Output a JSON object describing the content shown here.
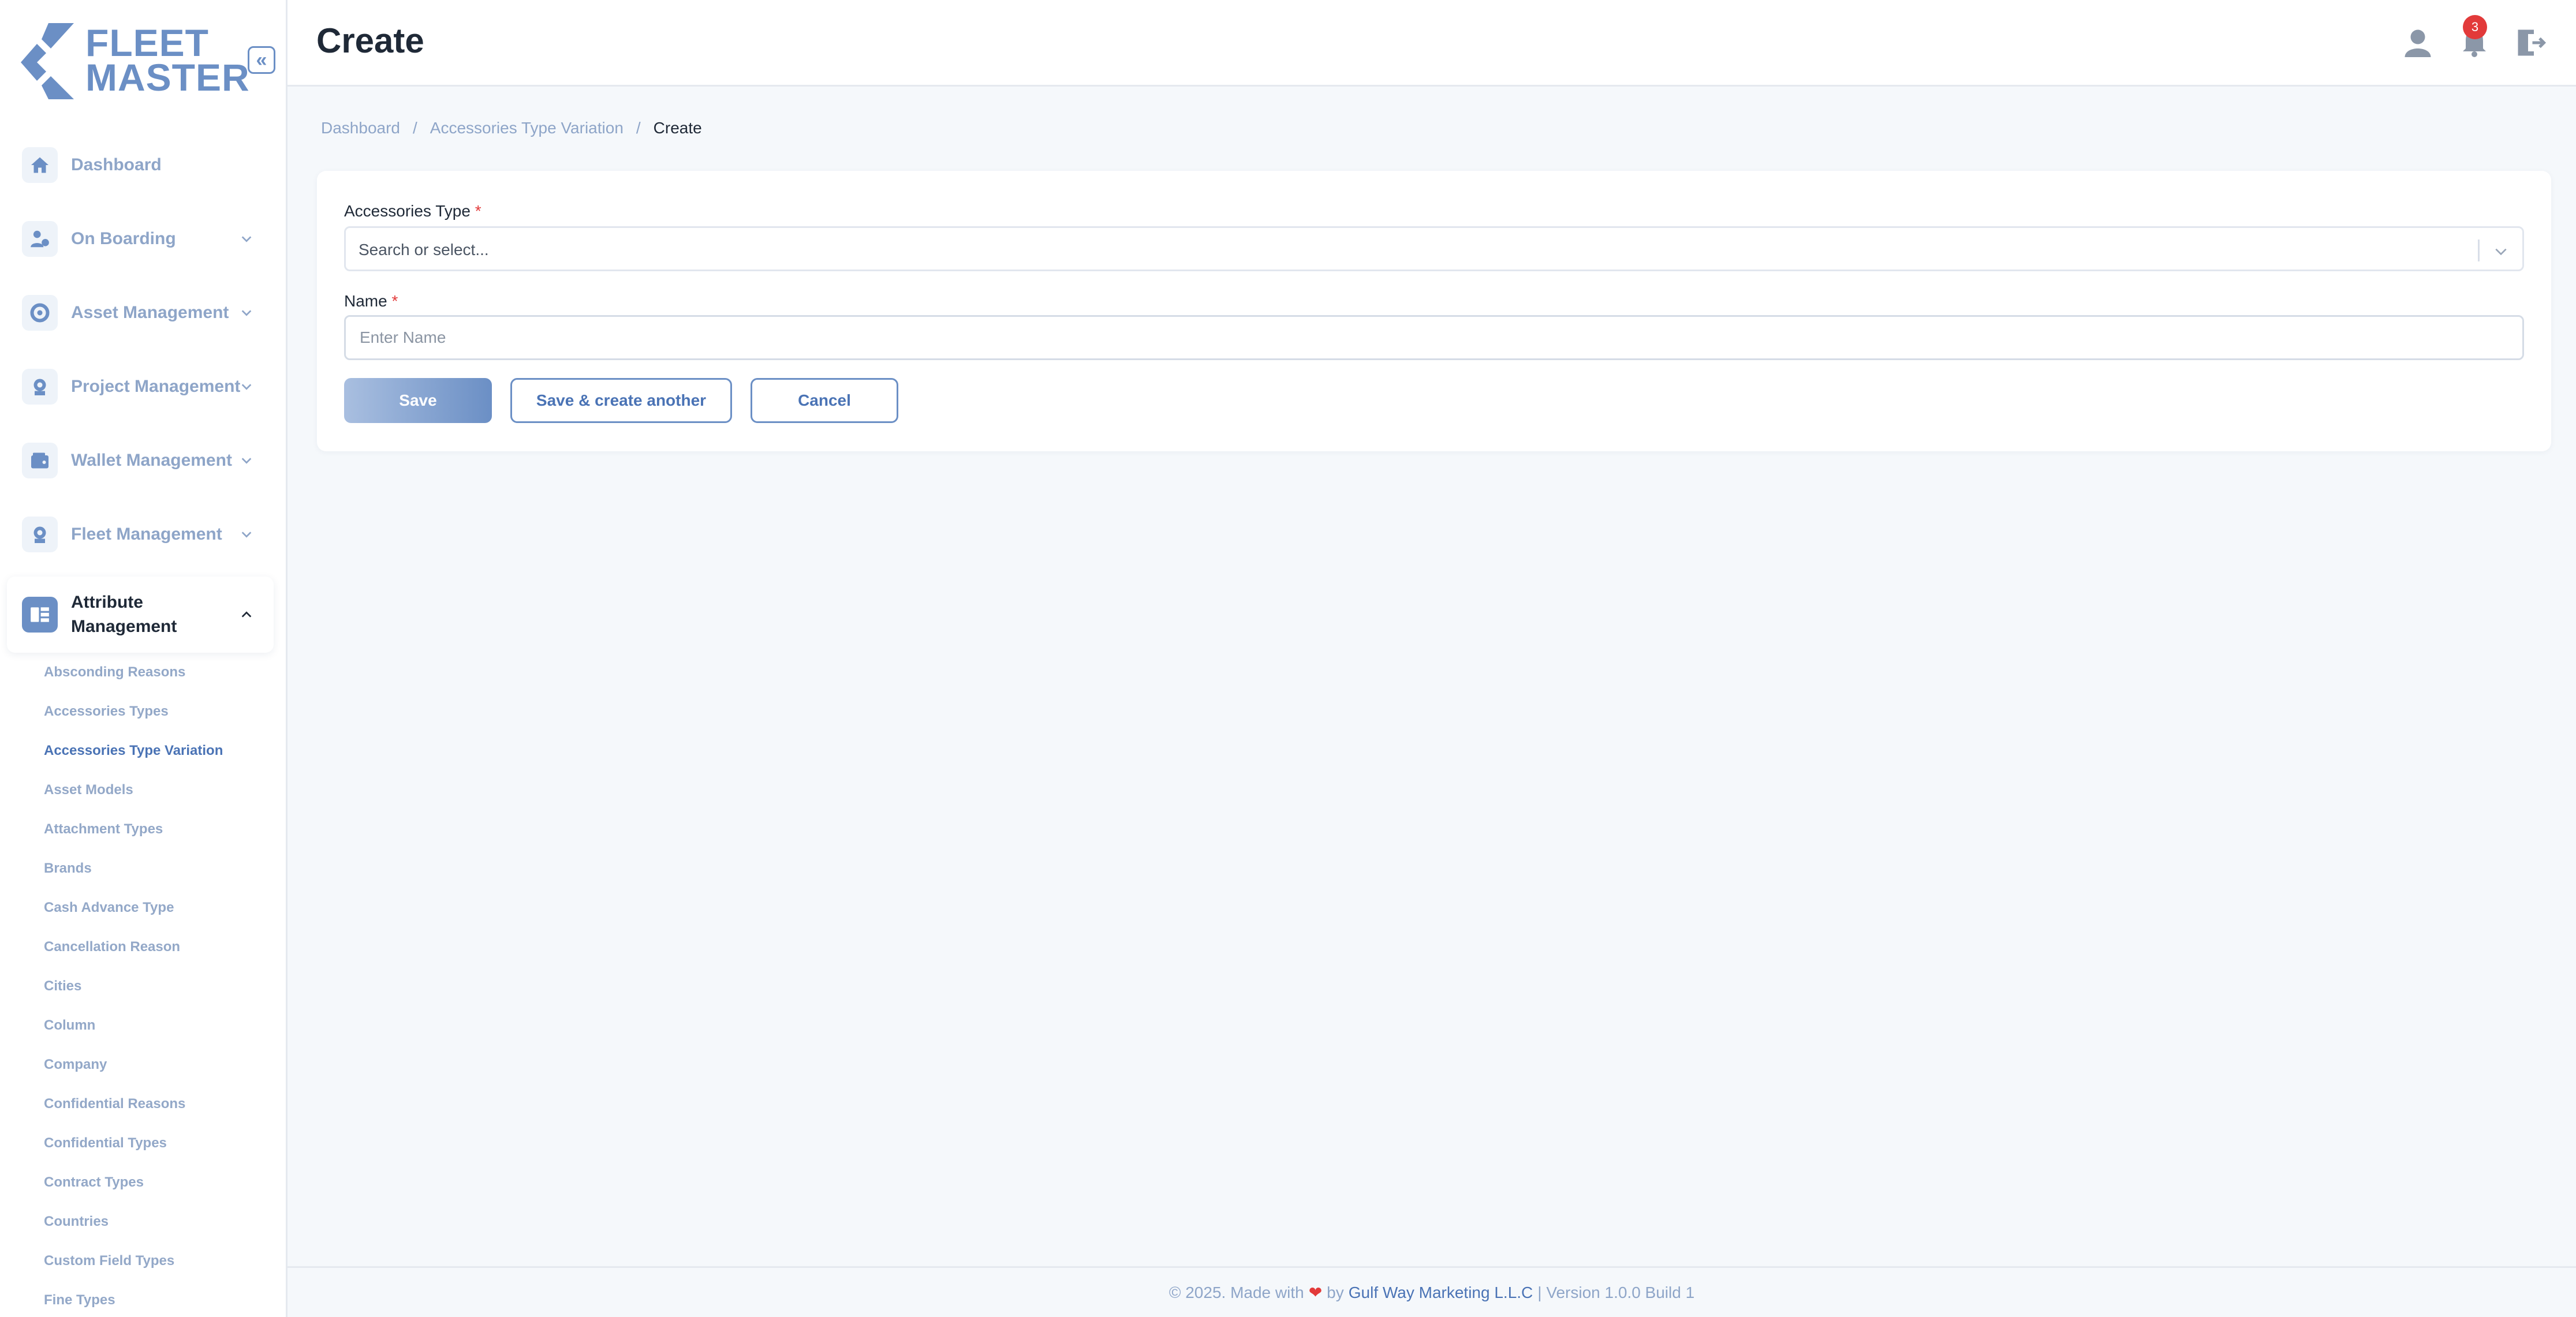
{
  "app": {
    "logo_line1": "FLEET",
    "logo_line2": "MASTER"
  },
  "header": {
    "title": "Create",
    "notification_count": "3"
  },
  "sidebar": {
    "collapse_glyph": "«",
    "items": [
      {
        "label": "Dashboard",
        "icon": "home-icon"
      },
      {
        "label": "On Boarding",
        "icon": "user-onboarding-icon"
      },
      {
        "label": "Asset Management",
        "icon": "asset-icon"
      },
      {
        "label": "Project Management",
        "icon": "project-icon"
      },
      {
        "label": "Wallet Management",
        "icon": "wallet-icon"
      },
      {
        "label": "Fleet Management",
        "icon": "fleet-icon"
      },
      {
        "label_line1": "Attribute",
        "label_line2": "Management",
        "icon": "attribute-icon"
      }
    ],
    "sub_items": [
      "Absconding Reasons",
      "Accessories Types",
      "Accessories Type Variation",
      "Asset Models",
      "Attachment Types",
      "Brands",
      "Cash Advance Type",
      "Cancellation Reason",
      "Cities",
      "Column",
      "Company",
      "Confidential Reasons",
      "Confidential Types",
      "Contract Types",
      "Countries",
      "Custom Field Types",
      "Fine Types"
    ]
  },
  "breadcrumb": {
    "items": [
      "Dashboard",
      "Accessories Type Variation",
      "Create"
    ],
    "separator": "/"
  },
  "form": {
    "accessories_type_label": "Accessories Type",
    "required_mark": "*",
    "accessories_type_placeholder": "Search or select...",
    "name_label": "Name",
    "name_placeholder": "Enter Name",
    "save_label": "Save",
    "save_another_label": "Save & create another",
    "cancel_label": "Cancel"
  },
  "footer": {
    "prefix": "© 2025. Made with",
    "heart": "❤",
    "by": "by",
    "company": "Gulf Way Marketing L.L.C",
    "version": "| Version 1.0.0 Build 1"
  },
  "colors": {
    "accent": "#6b8fc5",
    "link": "#4a73b5",
    "danger": "#e23a3a"
  }
}
